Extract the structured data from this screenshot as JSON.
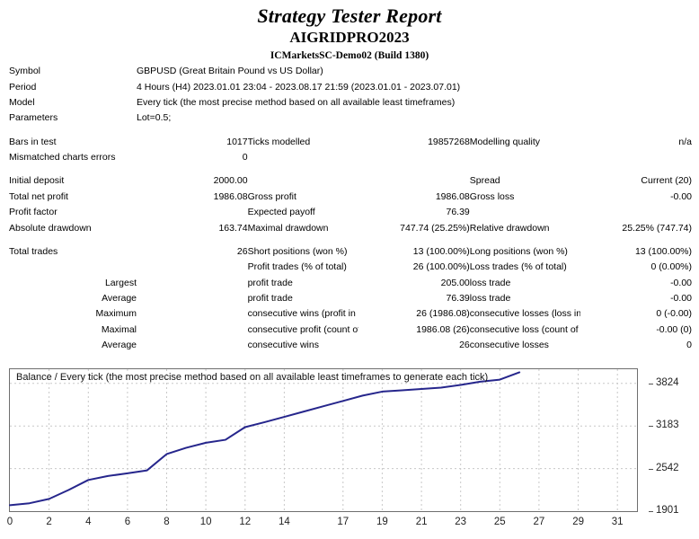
{
  "header": {
    "title": "Strategy Tester Report",
    "ea_name": "AIGRIDPRO2023",
    "broker": "ICMarketsSC-Demo02 (Build 1380)"
  },
  "info": {
    "symbol_label": "Symbol",
    "symbol_value": "GBPUSD (Great Britain Pound vs US Dollar)",
    "period_label": "Period",
    "period_value": "4 Hours (H4) 2023.01.01 23:04 - 2023.08.17 21:59 (2023.01.01 - 2023.07.01)",
    "model_label": "Model",
    "model_value": "Every tick (the most precise method based on all available least timeframes)",
    "parameters_label": "Parameters",
    "parameters_value": "Lot=0.5;",
    "bars_label": "Bars in test",
    "bars_value": "1017",
    "ticks_label": "Ticks modelled",
    "ticks_value": "19857268",
    "quality_label": "Modelling quality",
    "quality_value": "n/a",
    "mismatched_label": "Mismatched charts errors",
    "mismatched_value": "0",
    "initial_deposit_label": "Initial deposit",
    "initial_deposit_value": "2000.00",
    "spread_label": "Spread",
    "spread_value": "Current (20)",
    "total_net_profit_label": "Total net profit",
    "total_net_profit_value": "1986.08",
    "gross_profit_label": "Gross profit",
    "gross_profit_value": "1986.08",
    "gross_loss_label": "Gross loss",
    "gross_loss_value": "-0.00",
    "profit_factor_label": "Profit factor",
    "profit_factor_value": "",
    "expected_payoff_label": "Expected payoff",
    "expected_payoff_value": "76.39",
    "absolute_drawdown_label": "Absolute drawdown",
    "absolute_drawdown_value": "163.74",
    "maximal_drawdown_label": "Maximal drawdown",
    "maximal_drawdown_value": "747.74 (25.25%)",
    "relative_drawdown_label": "Relative drawdown",
    "relative_drawdown_value": "25.25% (747.74)",
    "total_trades_label": "Total trades",
    "total_trades_value": "26",
    "short_positions_label": "Short positions (won %)",
    "short_positions_value": "13 (100.00%)",
    "long_positions_label": "Long positions (won %)",
    "long_positions_value": "13 (100.00%)",
    "profit_trades_label": "Profit trades (% of total)",
    "profit_trades_value": "26 (100.00%)",
    "loss_trades_label": "Loss trades (% of total)",
    "loss_trades_value": "0 (0.00%)",
    "largest_label": "Largest",
    "largest_profit_trade_label": "profit trade",
    "largest_profit_trade_value": "205.00",
    "largest_loss_trade_label": "loss trade",
    "largest_loss_trade_value": "-0.00",
    "average_label": "Average",
    "average_profit_trade_label": "profit trade",
    "average_profit_trade_value": "76.39",
    "average_loss_trade_label": "loss trade",
    "average_loss_trade_value": "-0.00",
    "maximum_label": "Maximum",
    "max_consecutive_wins_label": "consecutive wins (profit in money)",
    "max_consecutive_wins_value": "26 (1986.08)",
    "max_consecutive_losses_label": "consecutive losses (loss in money)",
    "max_consecutive_losses_value": "0 (-0.00)",
    "maximal_label": "Maximal",
    "maximal_consecutive_profit_label": "consecutive profit (count of wins)",
    "maximal_consecutive_profit_value": "1986.08 (26)",
    "maximal_consecutive_loss_label": "consecutive loss (count of losses)",
    "maximal_consecutive_loss_value": "-0.00 (0)",
    "average2_label": "Average",
    "avg_consecutive_wins_label": "consecutive wins",
    "avg_consecutive_wins_value": "26",
    "avg_consecutive_losses_label": "consecutive losses",
    "avg_consecutive_losses_value": "0"
  },
  "chart_data": {
    "type": "line",
    "title": "Balance / Every tick (the most precise method based on all available least timeframes to generate each tick)",
    "xlabel": "",
    "ylabel": "",
    "series_name": "Balance",
    "line_color": "#26268c",
    "grid": true,
    "legend_position": "top-left",
    "xlim": [
      0,
      32
    ],
    "ylim": [
      1901,
      4037
    ],
    "ytick_labels": [
      "3824",
      "3183",
      "2542",
      "1901"
    ],
    "yticks": [
      3824,
      3183,
      2542,
      1901
    ],
    "xtick_labels": [
      "0",
      "2",
      "4",
      "6",
      "8",
      "10",
      "12",
      "14",
      "17",
      "19",
      "21",
      "23",
      "25",
      "27",
      "29",
      "31"
    ],
    "xticks": [
      0,
      2,
      4,
      6,
      8,
      10,
      12,
      14,
      17,
      19,
      21,
      23,
      25,
      27,
      29,
      31
    ],
    "x": [
      0,
      1,
      2,
      3,
      4,
      5,
      6,
      7,
      8,
      9,
      10,
      11,
      12,
      13,
      14,
      15,
      16,
      17,
      18,
      19,
      20,
      21,
      22,
      23,
      24,
      25,
      26
    ],
    "values": [
      1990,
      2020,
      2085,
      2220,
      2370,
      2430,
      2470,
      2515,
      2760,
      2855,
      2930,
      2975,
      3165,
      3240,
      3320,
      3400,
      3480,
      3560,
      3640,
      3700,
      3720,
      3740,
      3760,
      3800,
      3850,
      3880,
      3990
    ]
  }
}
